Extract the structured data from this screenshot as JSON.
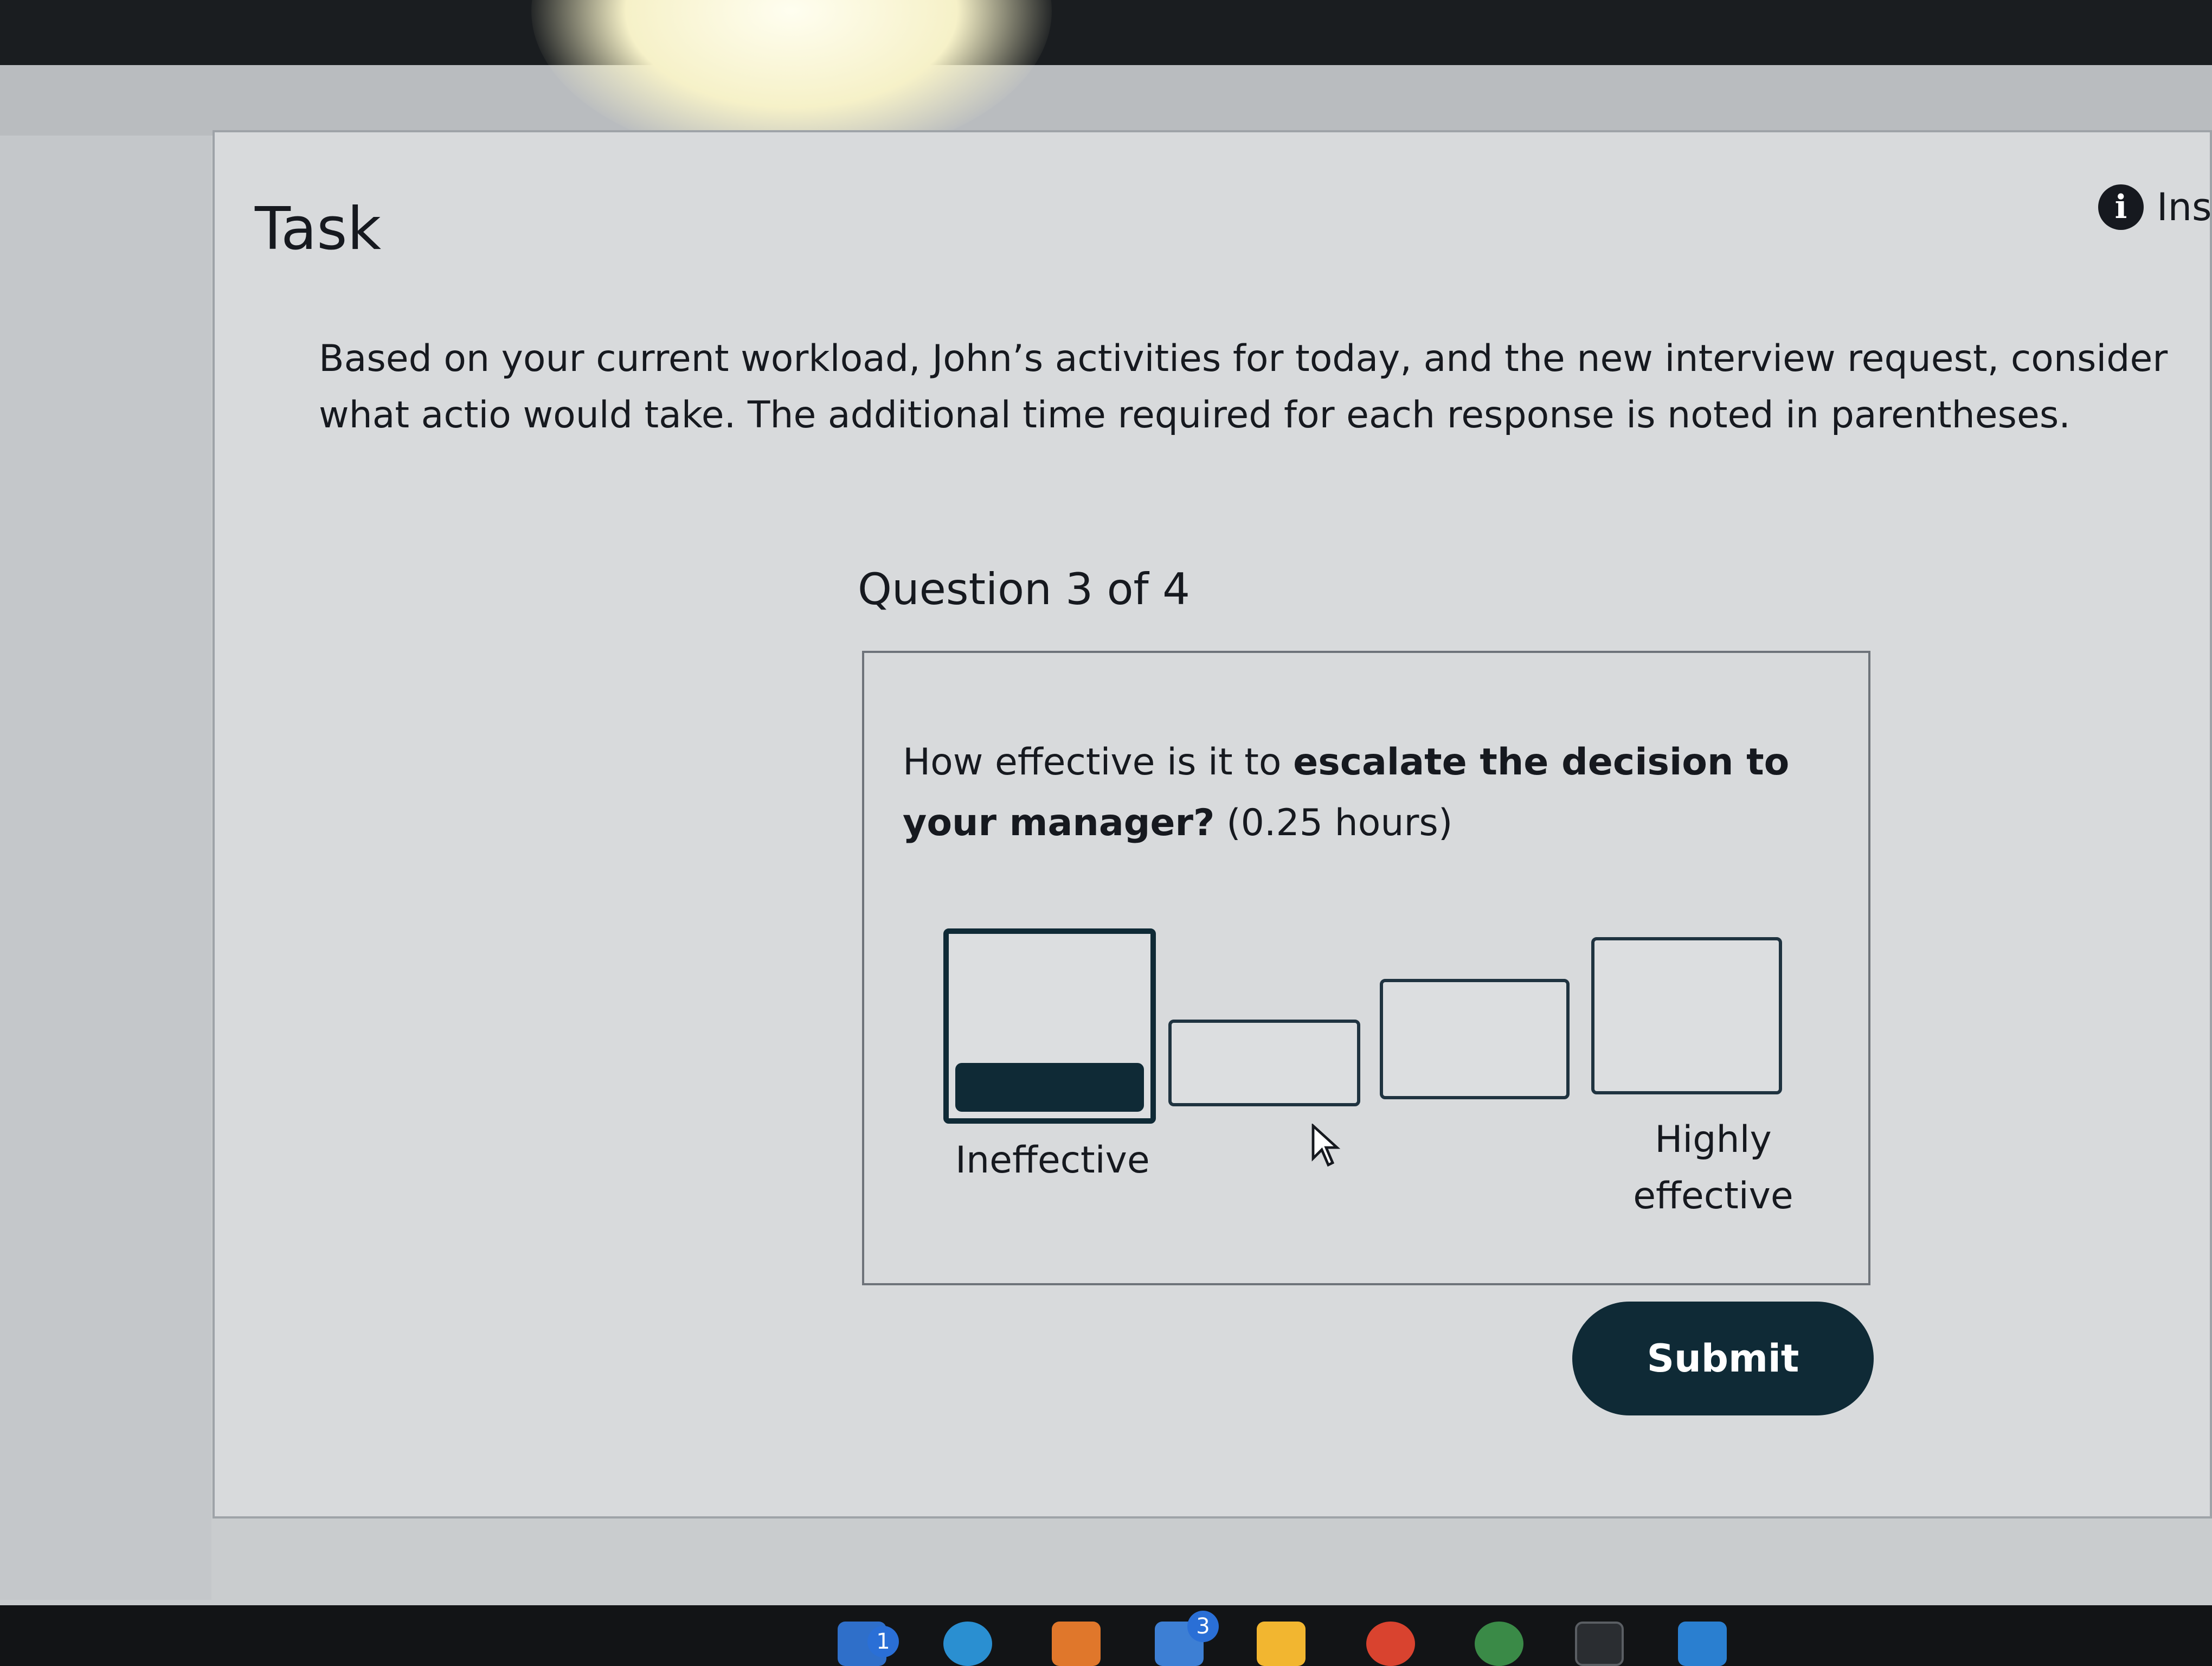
{
  "task": {
    "title": "Task",
    "info_label": "Inst",
    "intro": "Based on your current workload, John’s activities for today, and the new interview request, consider what actio would take. The additional time required for each response is noted in parentheses."
  },
  "question": {
    "counter": "Question 3 of 4",
    "prefix": "How effective is it to ",
    "bold": "escalate the decision to your manager?",
    "suffix": " (0.25 hours)",
    "scale": {
      "low_label": "Ineffective",
      "high_label": "Highly effective",
      "selected_index": 0,
      "option_count": 4
    }
  },
  "actions": {
    "submit_label": "Submit"
  },
  "taskbar": {
    "badges": [
      "1",
      "3"
    ],
    "icons": [
      "outlook-icon",
      "edge-icon",
      "sublime-icon",
      "mail-icon",
      "file-explorer-icon",
      "chrome-icon",
      "chrome-profile-icon",
      "terminal-icon",
      "vscode-icon"
    ]
  }
}
